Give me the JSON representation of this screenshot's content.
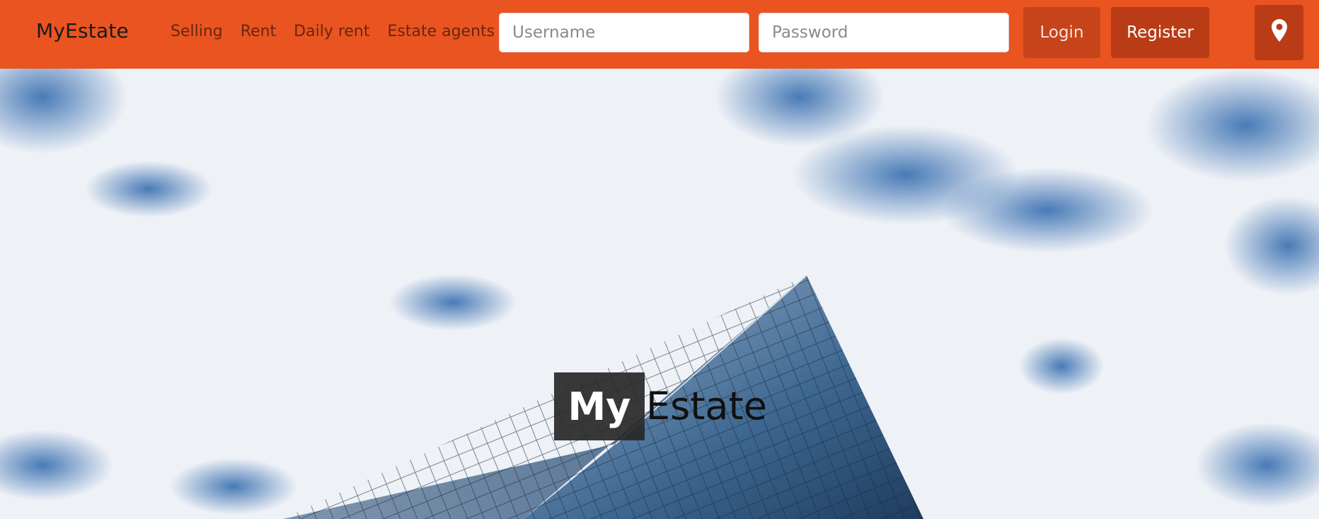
{
  "navbar": {
    "brand": "MyEstate",
    "links": [
      {
        "label": "Selling"
      },
      {
        "label": "Rent"
      },
      {
        "label": "Daily rent"
      },
      {
        "label": "Estate agents"
      }
    ],
    "username": {
      "placeholder": "Username",
      "value": ""
    },
    "password": {
      "placeholder": "Password",
      "value": ""
    },
    "login_label": "Login",
    "register_label": "Register",
    "location_icon": "map-marker-icon"
  },
  "hero": {
    "title_part1": "My",
    "title_part2": "Estate",
    "background_image": "building-against-cloudy-sky"
  },
  "colors": {
    "navbar": "#E95420",
    "button_dark": "#B93C16",
    "title_box": "#282828"
  }
}
